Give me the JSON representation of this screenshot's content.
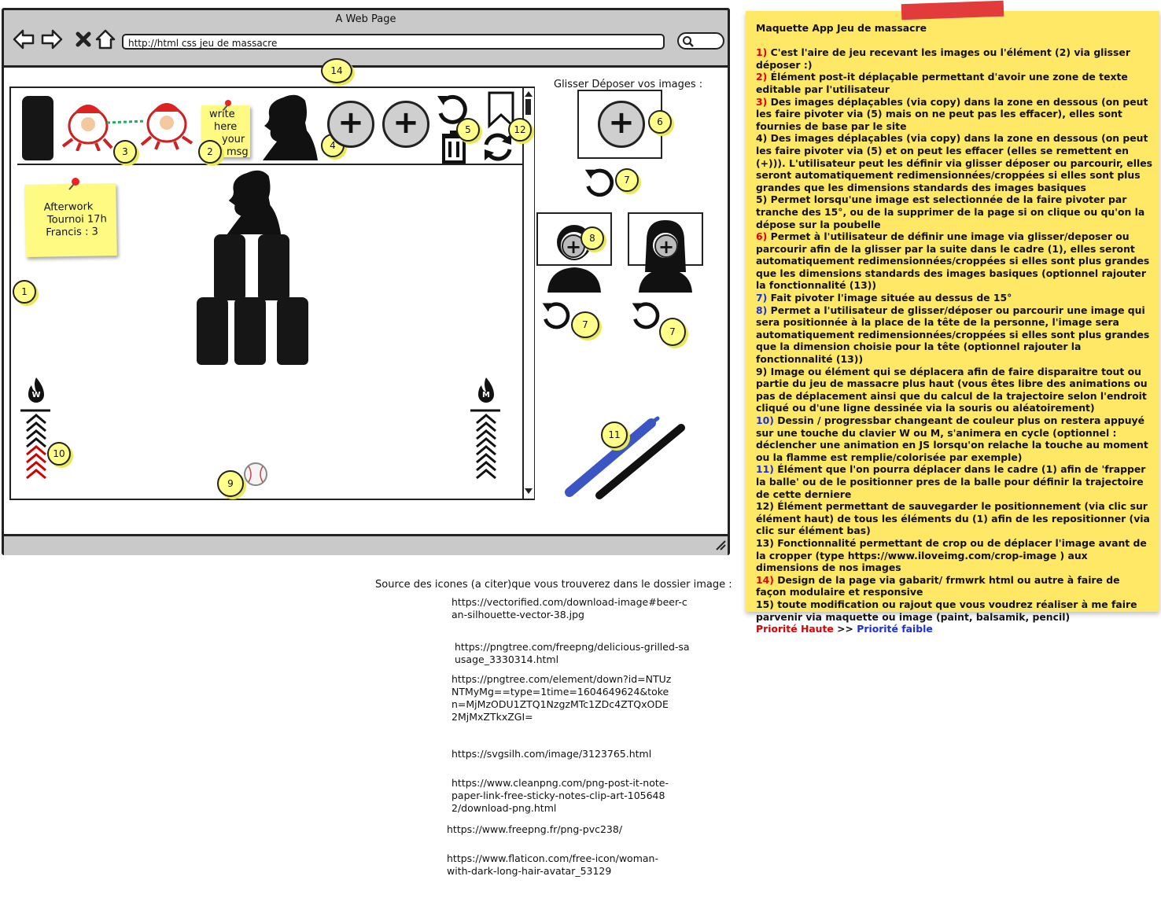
{
  "browser": {
    "window_title": "A Web Page",
    "url": "http://html css  jeu de massacre"
  },
  "game": {
    "postit_small": {
      "lines": [
        "write",
        "here",
        "your",
        "msg"
      ]
    },
    "postit_afterwork": {
      "lines": [
        "Afterwork",
        "Tournoi 17h",
        "Francis : 3"
      ]
    },
    "plus_label": "+",
    "flame_w_letter": "W",
    "flame_m_letter": "M"
  },
  "side_panel": {
    "drop_label": "Glisser Déposer vos images :"
  },
  "badges": {
    "b1": "1",
    "b2": "2",
    "b3": "3",
    "b4": "4",
    "b5": "5",
    "b6": "6",
    "b7": "7",
    "b8": "8",
    "b9": "9",
    "b10": "10",
    "b11": "11",
    "b12": "12",
    "b14": "14"
  },
  "sources": {
    "title": "Source des icones (a citer)que vous trouverez dans le dossier image :",
    "links": [
      "https://vectorified.com/download-image#beer-can-silhouette-vector-38.jpg",
      "https://pngtree.com/freepng/delicious-grilled-sausage_3330314.html",
      "https://pngtree.com/element/down?id=NTUzNTMyMg==type=1time=1604649624&token=MjMzODU1ZTQ1NzgzMTc1ZDc4ZTQxODE2MjMxZTkxZGI=",
      "https://svgsilh.com/image/3123765.html",
      "https://www.cleanpng.com/png-post-it-note-paper-link-free-sticky-notes-clip-art-1056482/download-png.html",
      "https://www.freepng.fr/png-pvc238/",
      "https://www.flaticon.com/free-icon/woman-with-dark-long-hair-avatar_53129"
    ]
  },
  "notes": {
    "title": "Maquette App Jeu de massacre",
    "items": [
      {
        "num": "1)",
        "text": " C'est l'aire de jeu recevant les images ou l'élément (2) via glisser déposer :)"
      },
      {
        "num": "2)",
        "text": " Élément post-it déplaçable permettant d'avoir une zone de texte editable par l'utilisateur"
      },
      {
        "num": "3)",
        "text": " Des images déplaçables (via copy) dans la zone en dessous (on peut les faire pivoter via (5) mais on ne peut pas les effacer), elles sont fournies de base par le site"
      },
      {
        "num": "4)",
        "text": " Des images déplaçables (via copy) dans la zone en dessous (on peut les faire pivoter via (5) et on  peut les effacer (elles se remettent en (+))). L'utilisateur peut les définir via glisser déposer ou parcourir, elles seront automatiquement redimensionnées/croppées si elles sont plus grandes que les dimensions standards des images basiques"
      },
      {
        "num": "5)",
        "text": " Permet lorsqu'une image est selectionnée de la faire pivoter par tranche des 15°, ou de la supprimer de la page si on clique ou qu'on la dépose sur la poubelle"
      },
      {
        "num": "6)",
        "text": "  Permet à l'utilisateur de définir une image via glisser/deposer ou parcourir afin de la glisser par la suite dans le cadre (1), elles seront automatiquement redimensionnées/croppées si elles sont plus grandes que les dimensions standards des images basiques (optionnel rajouter la fonctionnalité (13))"
      },
      {
        "num": "7)",
        "text": " Fait pivoter l'image située au dessus de 15°"
      },
      {
        "num": "8)",
        "text": " Permet a l'utilisateur de glisser/déposer ou parcourir une image qui sera positionnée à la place de la tête de la personne, l'image sera automatiquement redimensionnées/croppées si elles sont plus grandes que la dimension choisie pour la tête (optionnel rajouter la fonctionnalité (13))"
      },
      {
        "num": "9)",
        "text": " Image ou élément qui se déplacera afin de faire disparaitre tout ou partie du jeu de massacre plus haut (vous êtes libre des animations ou pas de déplacement ainsi que du calcul de la trajectoire selon l'endroit cliqué ou d'une ligne dessinée via la souris ou aléatoirement)"
      },
      {
        "num": "10)",
        "text": " Dessin / progressbar changeant de couleur plus on restera appuyé sur une touche du clavier W ou M, s'animera en cycle (optionnel : déclencher une animation en JS lorsqu'on relache la touche au moment ou la flamme est remplie/colorisée par exemple)"
      },
      {
        "num": "11)",
        "text": " Élément que l'on pourra déplacer dans le cadre (1) afin de 'frapper la balle' ou de le positionner pres de la balle pour définir la trajectoire de cette derniere"
      },
      {
        "num": "12)",
        "text": " Élément permettant de sauvegarder le positionnement (via clic sur élément haut) de tous les éléments du (1) afin de les repositionner (via clic sur élément bas)"
      },
      {
        "num": "13)",
        "text": " Fonctionnalité permettant de crop ou de déplacer l'image avant de la cropper (type https://www.iloveimg.com/crop-image ) aux dimensions de nos images"
      },
      {
        "num": "14)",
        "text": " Design de la page via gabarit/ frmwrk html ou autre à faire de façon modulaire et responsive"
      },
      {
        "num": "15)",
        "text": " toute modification ou rajout que vous voudrez réaliser à me faire parvenir via maquette ou image (paint, balsamik, pencil)"
      }
    ],
    "priority_high": "Priorité Haute",
    "priority_arrow": " >> ",
    "priority_low": "Priorité faible",
    "colors": {
      "high": "#e00000",
      "low": "#1a2fe0",
      "default": "#111111"
    }
  }
}
